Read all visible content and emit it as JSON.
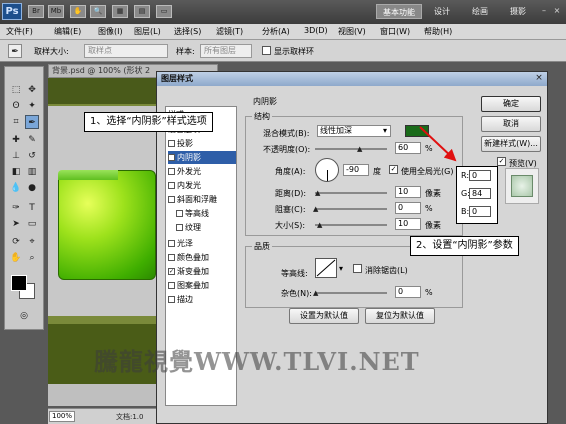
{
  "appbar": {
    "logo": "Ps",
    "workspaces": [
      "基本功能",
      "设计",
      "绘画",
      "摄影"
    ],
    "controls": [
      "–",
      "□",
      "×"
    ]
  },
  "menubar": [
    "文件(F)",
    "编辑(E)",
    "图像(I)",
    "图层(L)",
    "选择(S)",
    "滤镜(T)",
    "分析(A)",
    "3D(D)",
    "视图(V)",
    "窗口(W)",
    "帮助(H)"
  ],
  "optbar": {
    "sample_size_label": "取样大小:",
    "sample_size_value": "取样点",
    "sample_label": "样本:",
    "sample_value": "所有图层",
    "show_ring_label": "显示取样环"
  },
  "document": {
    "tab_title": "背景.psd @ 100% (形状 2",
    "zoom": "100%",
    "doc_info": "文档:1.0"
  },
  "dialog": {
    "title": "图层样式",
    "styles_header": "样式",
    "style_items": [
      {
        "label": "混合选项",
        "checked": false
      },
      {
        "label": "投影",
        "checked": false
      },
      {
        "label": "内阴影",
        "checked": true,
        "selected": true
      },
      {
        "label": "外发光",
        "checked": false
      },
      {
        "label": "内发光",
        "checked": false
      },
      {
        "label": "斜面和浮雕",
        "checked": false
      },
      {
        "label": "等高线",
        "checked": false,
        "indent": true
      },
      {
        "label": "纹理",
        "checked": false,
        "indent": true
      },
      {
        "label": "光泽",
        "checked": false
      },
      {
        "label": "颜色叠加",
        "checked": false
      },
      {
        "label": "渐变叠加",
        "checked": true
      },
      {
        "label": "图案叠加",
        "checked": false
      },
      {
        "label": "描边",
        "checked": false
      }
    ],
    "inner_shadow": {
      "section_title": "内阴影",
      "structure_title": "结构",
      "blend_mode_label": "混合模式(B):",
      "blend_mode_value": "线性加深",
      "opacity_label": "不透明度(O):",
      "opacity_value": "60",
      "angle_label": "角度(A):",
      "angle_value": "-90",
      "angle_unit": "度",
      "global_light_label": "使用全局光(G)",
      "distance_label": "距离(D):",
      "distance_value": "10",
      "choke_label": "阻塞(C):",
      "choke_value": "0",
      "size_label": "大小(S):",
      "size_value": "10",
      "px_unit": "像素",
      "pct_unit": "%",
      "quality_title": "品质",
      "contour_label": "等高线:",
      "antialias_label": "消除锯齿(L)",
      "noise_label": "杂色(N):",
      "noise_value": "0",
      "set_default": "设置为默认值",
      "reset_default": "复位为默认值"
    },
    "buttons": {
      "ok": "确定",
      "cancel": "取消",
      "new_style": "新建样式(W)...",
      "preview": "预览(V)"
    }
  },
  "annotations": {
    "step1": "1、选择“内阴影”样式选项",
    "step2": "2、设置“内阴影”参数",
    "rgb": {
      "r": "0",
      "g": "84",
      "b": "0"
    }
  },
  "watermark": "騰龍視覺WWW.TLVI.NET",
  "colors": {
    "shadow_color": "#1a6b1a",
    "selection": "#2e5ea8",
    "arrow": "#e01010"
  }
}
